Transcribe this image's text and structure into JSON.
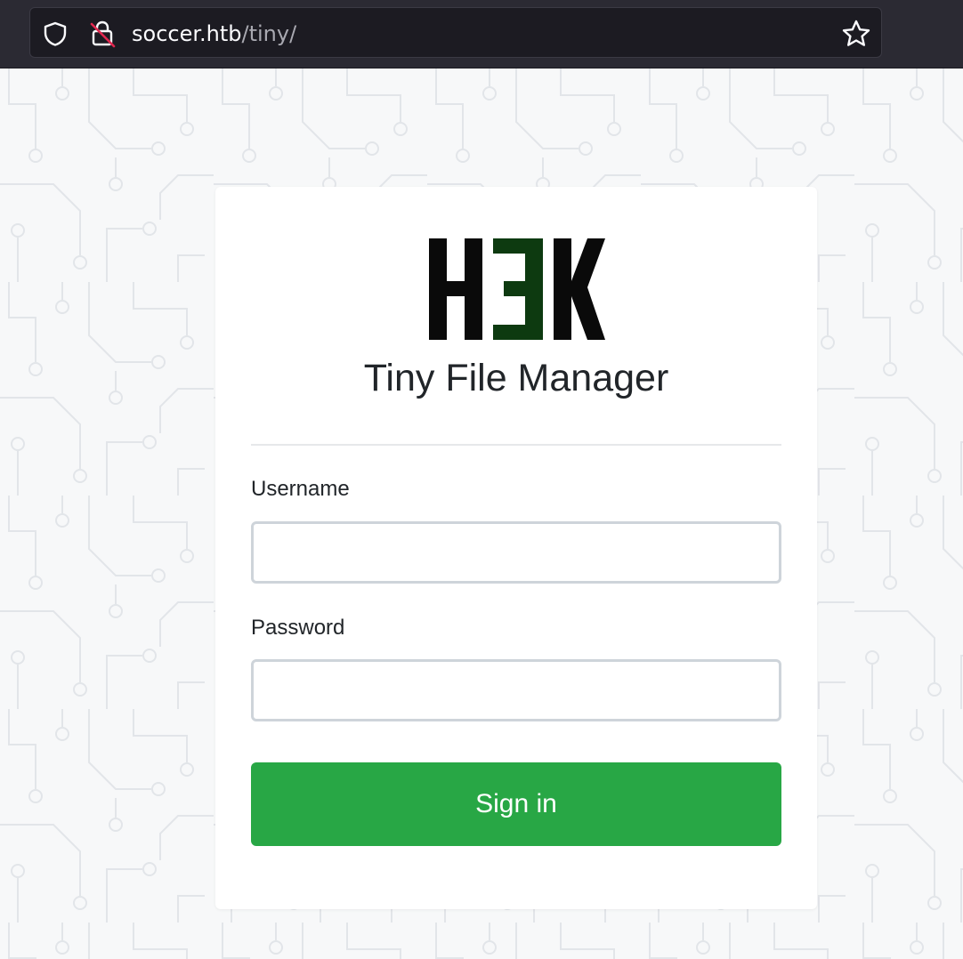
{
  "browser": {
    "url_host": "soccer.htb",
    "url_path": "/tiny/",
    "icons": [
      "shield-icon",
      "insecure-lock-icon",
      "bookmark-star-icon"
    ]
  },
  "login": {
    "logo_text": "H3K",
    "title": "Tiny File Manager",
    "username_label": "Username",
    "username_value": "",
    "password_label": "Password",
    "password_value": "",
    "submit_label": "Sign in"
  },
  "colors": {
    "accent": "#28a745",
    "logo_dark": "#0a0a0a",
    "logo_green": "#0d3a10",
    "text": "#212529",
    "input_border": "#ced4da"
  }
}
